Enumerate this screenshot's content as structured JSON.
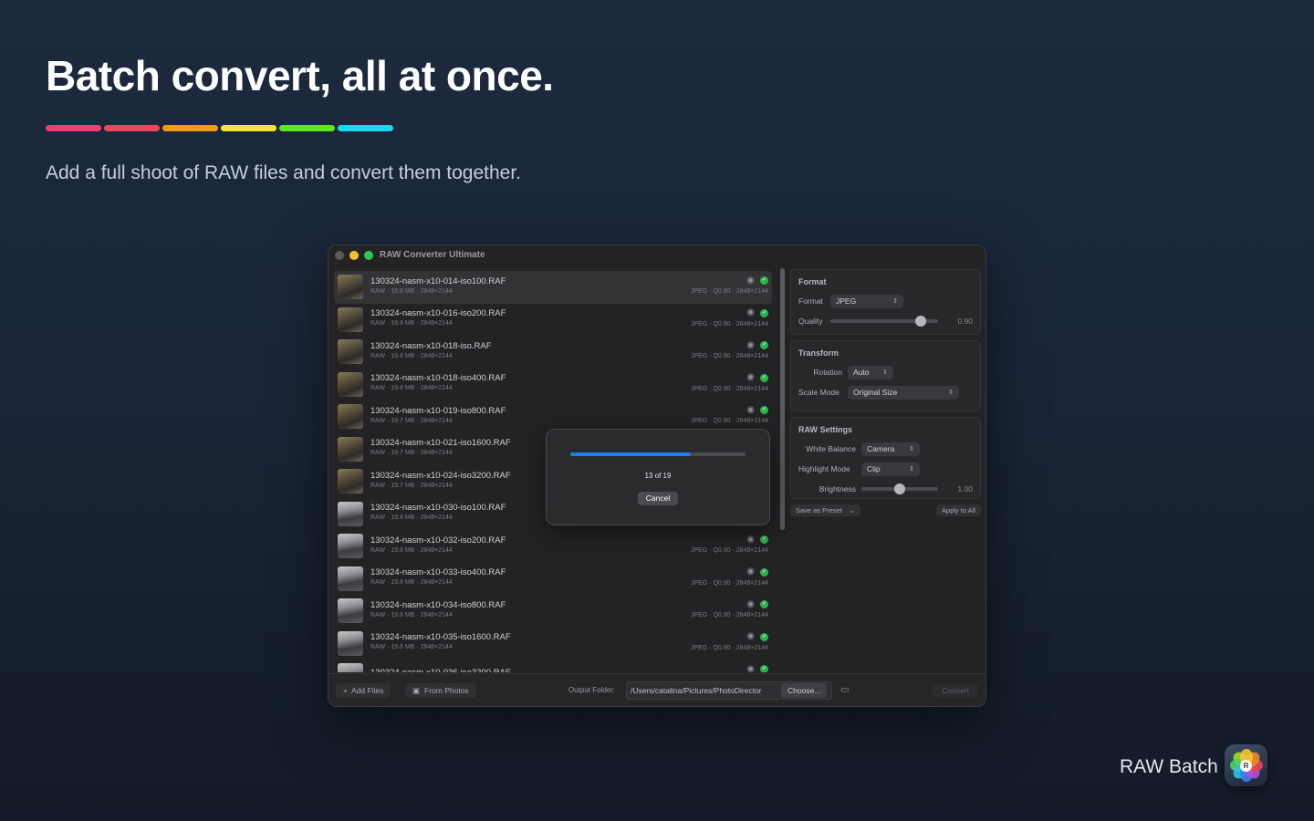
{
  "hero": {
    "headline": "Batch convert, all at once.",
    "subhead": "Add a full shoot of RAW files and convert them together.",
    "stripe_colors": [
      "#f03e74",
      "#e8485a",
      "#f29a12",
      "#f7e631",
      "#5fe81e",
      "#1ad6ee"
    ]
  },
  "window": {
    "title": "RAW Converter Ultimate",
    "traffic_lights": [
      "#5a5a5e",
      "#f6bf2f",
      "#2ec648"
    ]
  },
  "files": [
    {
      "name": "130324-nasm-x10-014-iso100.RAF",
      "meta": "RAW · 19.8 MB · 2848×2144",
      "out": "JPEG · Q0.90 · 2848×2144",
      "thumb": "a",
      "selected": true,
      "done": true
    },
    {
      "name": "130324-nasm-x10-016-iso200.RAF",
      "meta": "RAW · 19.8 MB · 2848×2144",
      "out": "JPEG · Q0.90 · 2848×2144",
      "thumb": "a",
      "done": true
    },
    {
      "name": "130324-nasm-x10-018-iso.RAF",
      "meta": "RAW · 19.8 MB · 2848×2144",
      "out": "JPEG · Q0.90 · 2848×2144",
      "thumb": "a",
      "done": true
    },
    {
      "name": "130324-nasm-x10-018-iso400.RAF",
      "meta": "RAW · 19.8 MB · 2848×2144",
      "out": "JPEG · Q0.90 · 2848×2144",
      "thumb": "a",
      "done": true
    },
    {
      "name": "130324-nasm-x10-019-iso800.RAF",
      "meta": "RAW · 19.7 MB · 2848×2144",
      "out": "JPEG · Q0.90 · 2848×2144",
      "thumb": "a",
      "done": true
    },
    {
      "name": "130324-nasm-x10-021-iso1600.RAF",
      "meta": "RAW · 19.7 MB · 2848×2144",
      "out": "",
      "thumb": "a",
      "done": false
    },
    {
      "name": "130324-nasm-x10-024-iso3200.RAF",
      "meta": "RAW · 19.7 MB · 2848×2144",
      "out": "",
      "thumb": "a",
      "done": false
    },
    {
      "name": "130324-nasm-x10-030-iso100.RAF",
      "meta": "RAW · 19.8 MB · 2848×2144",
      "out": "",
      "thumb": "b",
      "done": false
    },
    {
      "name": "130324-nasm-x10-032-iso200.RAF",
      "meta": "RAW · 19.8 MB · 2848×2144",
      "out": "JPEG · Q0.90 · 2848×2144",
      "thumb": "b",
      "done": true
    },
    {
      "name": "130324-nasm-x10-033-iso400.RAF",
      "meta": "RAW · 19.8 MB · 2848×2144",
      "out": "JPEG · Q0.90 · 2848×2144",
      "thumb": "b",
      "done": true
    },
    {
      "name": "130324-nasm-x10-034-iso800.RAF",
      "meta": "RAW · 19.8 MB · 2848×2144",
      "out": "JPEG · Q0.90 · 2848×2144",
      "thumb": "b",
      "done": true
    },
    {
      "name": "130324-nasm-x10-035-iso1600.RAF",
      "meta": "RAW · 19.8 MB · 2848×2144",
      "out": "JPEG · Q0.90 · 2848×2144",
      "thumb": "b",
      "done": true
    },
    {
      "name": "130324-nasm-x10-036-iso3200.RAF",
      "meta": "",
      "out": "",
      "thumb": "b",
      "done": true
    }
  ],
  "progress": {
    "count_text": "13 of 19",
    "fraction": 0.685,
    "cancel_label": "Cancel"
  },
  "settings": {
    "format": {
      "title": "Format",
      "format_label": "Format",
      "format_value": "JPEG",
      "quality_label": "Quality",
      "quality_value": "0.90",
      "quality_fraction": 0.84
    },
    "transform": {
      "title": "Transform",
      "rotation_label": "Rotation",
      "rotation_value": "Auto",
      "scale_label": "Scale Mode",
      "scale_value": "Original Size"
    },
    "raw": {
      "title": "RAW Settings",
      "wb_label": "White Balance",
      "wb_value": "Camera",
      "hl_label": "Highlight Mode",
      "hl_value": "Clip",
      "brightness_label": "Brightness",
      "brightness_value": "1.00",
      "brightness_fraction": 0.5
    },
    "save_preset_label": "Save as Preset",
    "apply_all_label": "Apply to All"
  },
  "bottom": {
    "add_files_label": "Add Files",
    "from_photos_label": "From Photos",
    "output_label": "Output Folder:",
    "output_path": "/Users/catalina/Pictures/PhotoDirector",
    "choose_label": "Choose...",
    "convert_label": "Convert"
  },
  "brand": {
    "name": "RAW Batch",
    "icon_letter": "R"
  }
}
